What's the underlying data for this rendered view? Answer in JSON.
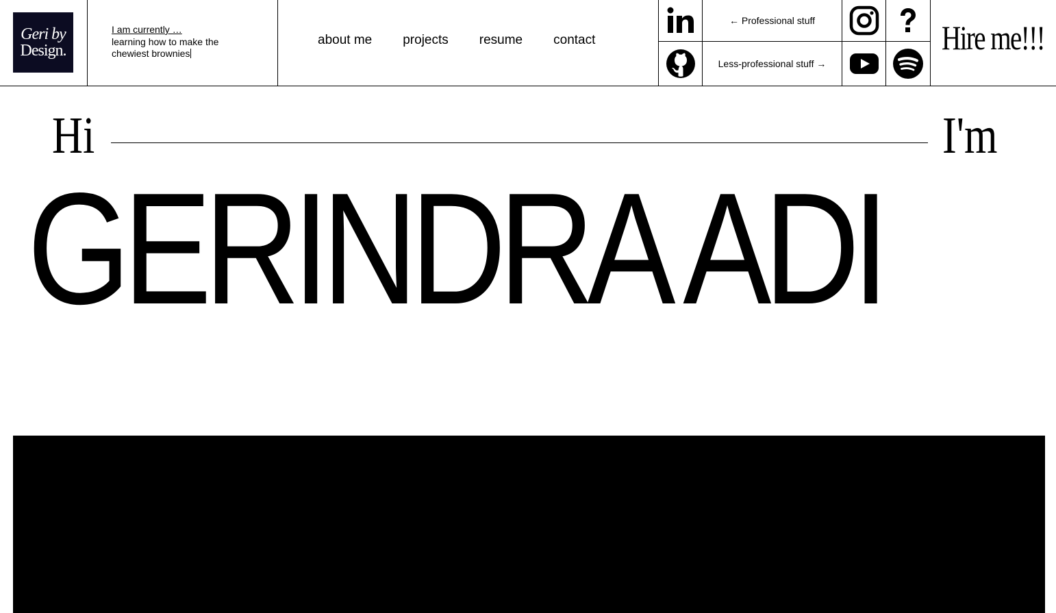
{
  "logo": {
    "line1": "Geri by",
    "line2": "Design."
  },
  "status": {
    "title": "I am currently …",
    "text": "learning how to make the chewiest brownies"
  },
  "nav": {
    "items": [
      {
        "label": "about me"
      },
      {
        "label": "projects"
      },
      {
        "label": "resume"
      },
      {
        "label": "contact"
      }
    ]
  },
  "links": {
    "professional": "← Professional stuff",
    "less_professional": "Less-professional stuff →",
    "icons": [
      "linkedin-icon",
      "github-icon",
      "instagram-icon",
      "question-icon",
      "youtube-icon",
      "spotify-icon"
    ]
  },
  "hire": {
    "label": "Hire me!!!"
  },
  "hero": {
    "hi": "Hi",
    "im": "I'm",
    "name": "GERINDRA ADI"
  }
}
